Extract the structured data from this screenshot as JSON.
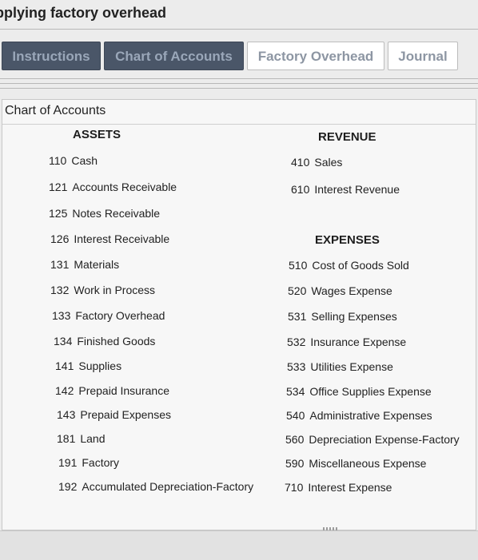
{
  "header": {
    "title": "pplying factory overhead"
  },
  "tabs": [
    {
      "label": "Instructions"
    },
    {
      "label": "Chart of Accounts"
    },
    {
      "label": "Factory Overhead"
    },
    {
      "label": "Journal"
    }
  ],
  "chart": {
    "heading": "Chart of Accounts",
    "assets": {
      "heading": "ASSETS",
      "accounts": [
        {
          "num": "110",
          "name": "Cash"
        },
        {
          "num": "121",
          "name": "Accounts Receivable"
        },
        {
          "num": "125",
          "name": "Notes Receivable"
        },
        {
          "num": "126",
          "name": "Interest Receivable"
        },
        {
          "num": "131",
          "name": "Materials"
        },
        {
          "num": "132",
          "name": "Work in Process"
        },
        {
          "num": "133",
          "name": "Factory Overhead"
        },
        {
          "num": "134",
          "name": "Finished Goods"
        },
        {
          "num": "141",
          "name": "Supplies"
        },
        {
          "num": "142",
          "name": "Prepaid Insurance"
        },
        {
          "num": "143",
          "name": "Prepaid Expenses"
        },
        {
          "num": "181",
          "name": "Land"
        },
        {
          "num": "191",
          "name": "Factory"
        },
        {
          "num": "192",
          "name": "Accumulated Depreciation-Factory"
        }
      ]
    },
    "revenue": {
      "heading": "REVENUE",
      "accounts": [
        {
          "num": "410",
          "name": "Sales"
        },
        {
          "num": "610",
          "name": "Interest Revenue"
        }
      ]
    },
    "expenses": {
      "heading": "EXPENSES",
      "accounts": [
        {
          "num": "510",
          "name": "Cost of Goods Sold"
        },
        {
          "num": "520",
          "name": "Wages Expense"
        },
        {
          "num": "531",
          "name": "Selling Expenses"
        },
        {
          "num": "532",
          "name": "Insurance Expense"
        },
        {
          "num": "533",
          "name": "Utilities Expense"
        },
        {
          "num": "534",
          "name": "Office Supplies Expense"
        },
        {
          "num": "540",
          "name": "Administrative Expenses"
        },
        {
          "num": "560",
          "name": "Depreciation Expense-Factory"
        },
        {
          "num": "590",
          "name": "Miscellaneous Expense"
        },
        {
          "num": "710",
          "name": "Interest Expense"
        }
      ]
    }
  }
}
